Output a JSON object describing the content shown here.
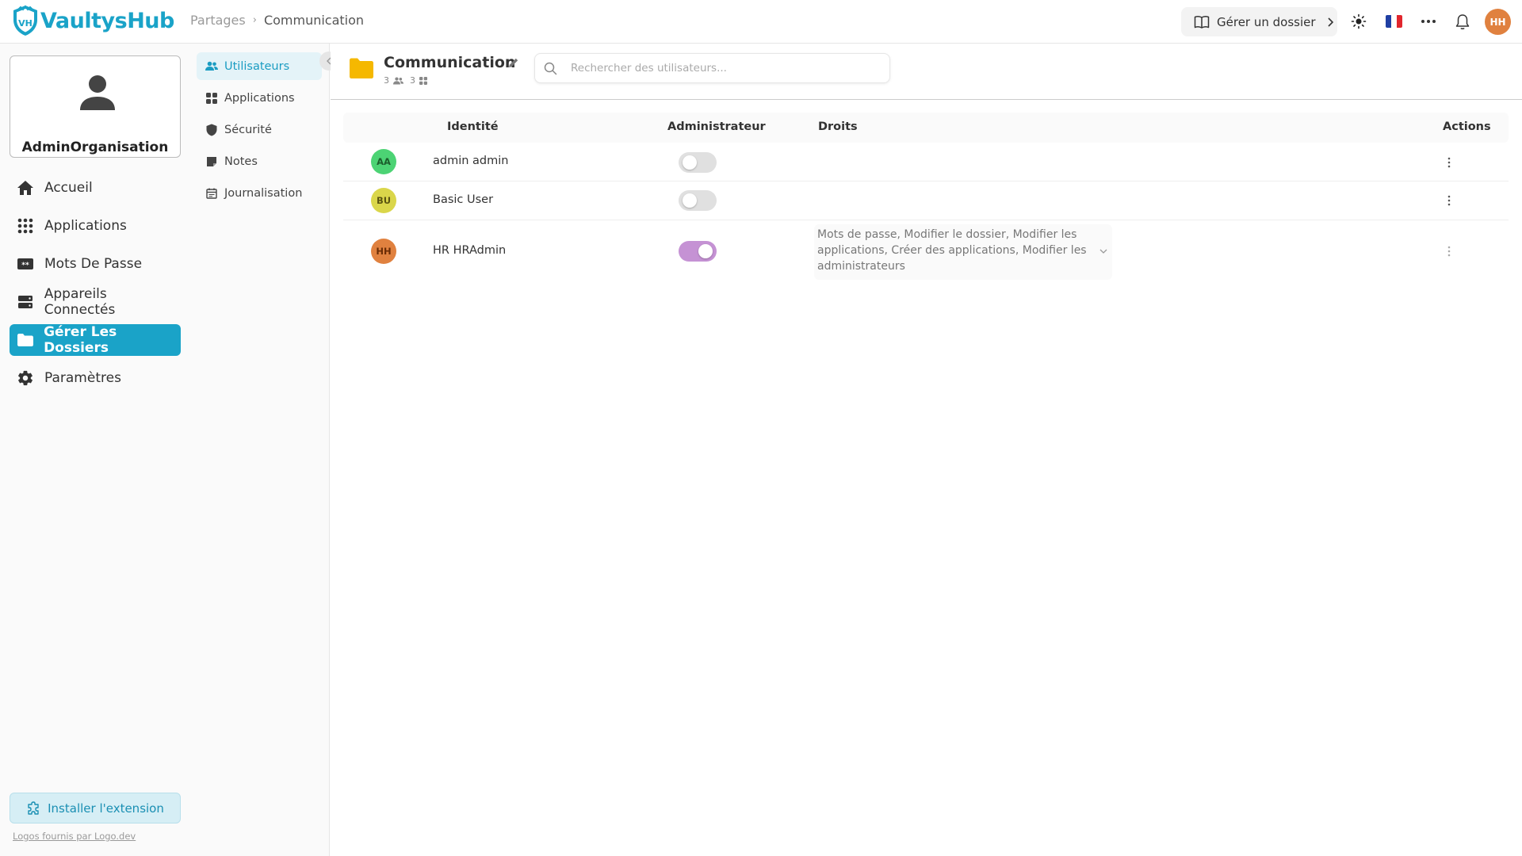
{
  "app": {
    "name": "VaultysHub"
  },
  "breadcrumb": {
    "parent": "Partages",
    "separator": "›",
    "current": "Communication"
  },
  "header": {
    "manage_label": "Gérer un dossier",
    "user_initials": "HH",
    "user_color": "#e0813f"
  },
  "sidebar": {
    "org_name": "AdminOrganisation",
    "items": [
      {
        "label": "Accueil",
        "icon": "home-icon",
        "active": false
      },
      {
        "label": "Applications",
        "icon": "grid-icon",
        "active": false
      },
      {
        "label": "Mots De Passe",
        "icon": "password-icon",
        "active": false
      },
      {
        "label": "Appareils Connectés",
        "icon": "devices-icon",
        "active": false
      },
      {
        "label": "Gérer Les Dossiers",
        "icon": "folder-icon",
        "active": true
      },
      {
        "label": "Paramètres",
        "icon": "gear-icon",
        "active": false
      }
    ],
    "install_label": "Installer l'extension",
    "logos_credit": "Logos fournis par Logo.dev",
    "accent_color": "#1aa3c8"
  },
  "subnav": {
    "items": [
      {
        "label": "Utilisateurs",
        "icon": "users-icon",
        "active": true
      },
      {
        "label": "Applications",
        "icon": "grid-icon",
        "active": false
      },
      {
        "label": "Sécurité",
        "icon": "shield-icon",
        "active": false
      },
      {
        "label": "Notes",
        "icon": "note-icon",
        "active": false
      },
      {
        "label": "Journalisation",
        "icon": "calendar-icon",
        "active": false
      }
    ]
  },
  "folder": {
    "title": "Communication",
    "user_count": "3",
    "app_count": "3"
  },
  "search": {
    "placeholder": "Rechercher des utilisateurs..."
  },
  "table": {
    "headers": {
      "identity": "Identité",
      "admin": "Administrateur",
      "rights": "Droits",
      "actions": "Actions"
    },
    "rows": [
      {
        "initials": "AA",
        "name": "admin admin",
        "admin": false,
        "rights": "",
        "avatar_bg": "#4cd374",
        "avatar_fg": "#1b5e2c"
      },
      {
        "initials": "BU",
        "name": "Basic User",
        "admin": false,
        "rights": "",
        "avatar_bg": "#dad64a",
        "avatar_fg": "#5a5410"
      },
      {
        "initials": "HH",
        "name": "HR HRAdmin",
        "admin": true,
        "rights": "Mots de passe, Modifier le dossier, Modifier les applications, Créer des applications, Modifier les administrateurs",
        "avatar_bg": "#e0813f",
        "avatar_fg": "#6a2c05"
      }
    ]
  }
}
